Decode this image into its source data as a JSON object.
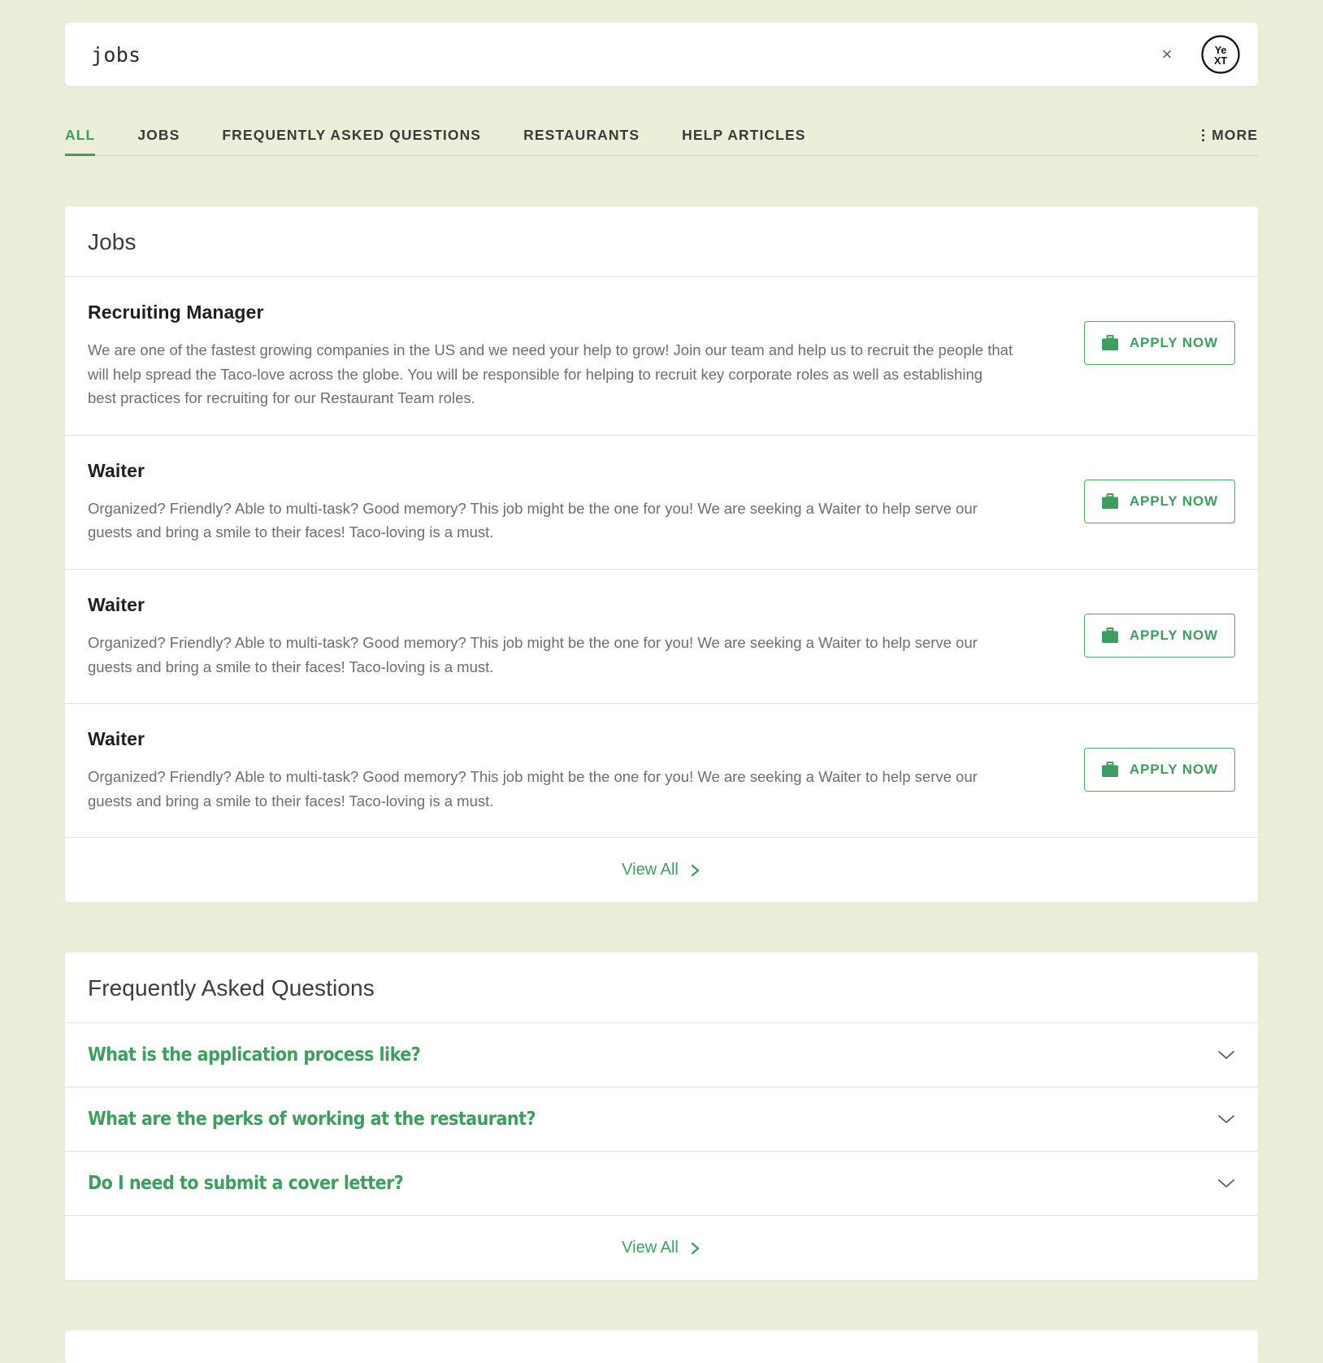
{
  "theme": {
    "page_bg": "#EDEEDA",
    "accent_green": "#3d9e5f",
    "button_border_green": "#49b06a",
    "card_bg": "#FFFFFF",
    "body_text": "#6e6e6e",
    "heading_text": "#1f1f1f"
  },
  "search": {
    "value": "jobs",
    "placeholder": "Search",
    "clear_label": "×",
    "clear_icon": "close-icon",
    "logo_icon": "yext-logo-icon",
    "logo_text_top": "Ye",
    "logo_text_bottom": "XT"
  },
  "tabs": {
    "items": [
      {
        "label": "ALL",
        "active": true
      },
      {
        "label": "JOBS",
        "active": false
      },
      {
        "label": "FREQUENTLY ASKED QUESTIONS",
        "active": false
      },
      {
        "label": "RESTAURANTS",
        "active": false
      },
      {
        "label": "HELP ARTICLES",
        "active": false
      }
    ],
    "more_label": "MORE",
    "more_icon": "vertical-dots-icon"
  },
  "jobs_section": {
    "title": "Jobs",
    "view_all_label": "View All",
    "view_all_icon": "chevron-right-icon",
    "apply_label": "APPLY NOW",
    "apply_icon": "briefcase-icon",
    "items": [
      {
        "title": "Recruiting Manager",
        "description": "We are one of the fastest growing companies in the US and we need your help to grow! Join our team and help us to recruit the people that will help spread the Taco-love across the globe. You will be responsible for helping to recruit key corporate roles as well as establishing best practices for recruiting for our Restaurant Team roles."
      },
      {
        "title": "Waiter",
        "description": "Organized? Friendly? Able to multi-task? Good memory? This job might be the one for you! We are seeking a Waiter to help serve our guests and bring a smile to their faces! Taco-loving is a must."
      },
      {
        "title": "Waiter",
        "description": "Organized? Friendly? Able to multi-task? Good memory? This job might be the one for you! We are seeking a Waiter to help serve our guests and bring a smile to their faces! Taco-loving is a must."
      },
      {
        "title": "Waiter",
        "description": "Organized? Friendly? Able to multi-task? Good memory? This job might be the one for you! We are seeking a Waiter to help serve our guests and bring a smile to their faces! Taco-loving is a must."
      }
    ]
  },
  "faq_section": {
    "title": "Frequently Asked Questions",
    "view_all_label": "View All",
    "view_all_icon": "chevron-right-icon",
    "expand_icon": "chevron-down-icon",
    "items": [
      {
        "question": "What is the application process like?"
      },
      {
        "question": "What are the perks of working at the restaurant?"
      },
      {
        "question": "Do I need to submit a cover letter?"
      }
    ]
  }
}
